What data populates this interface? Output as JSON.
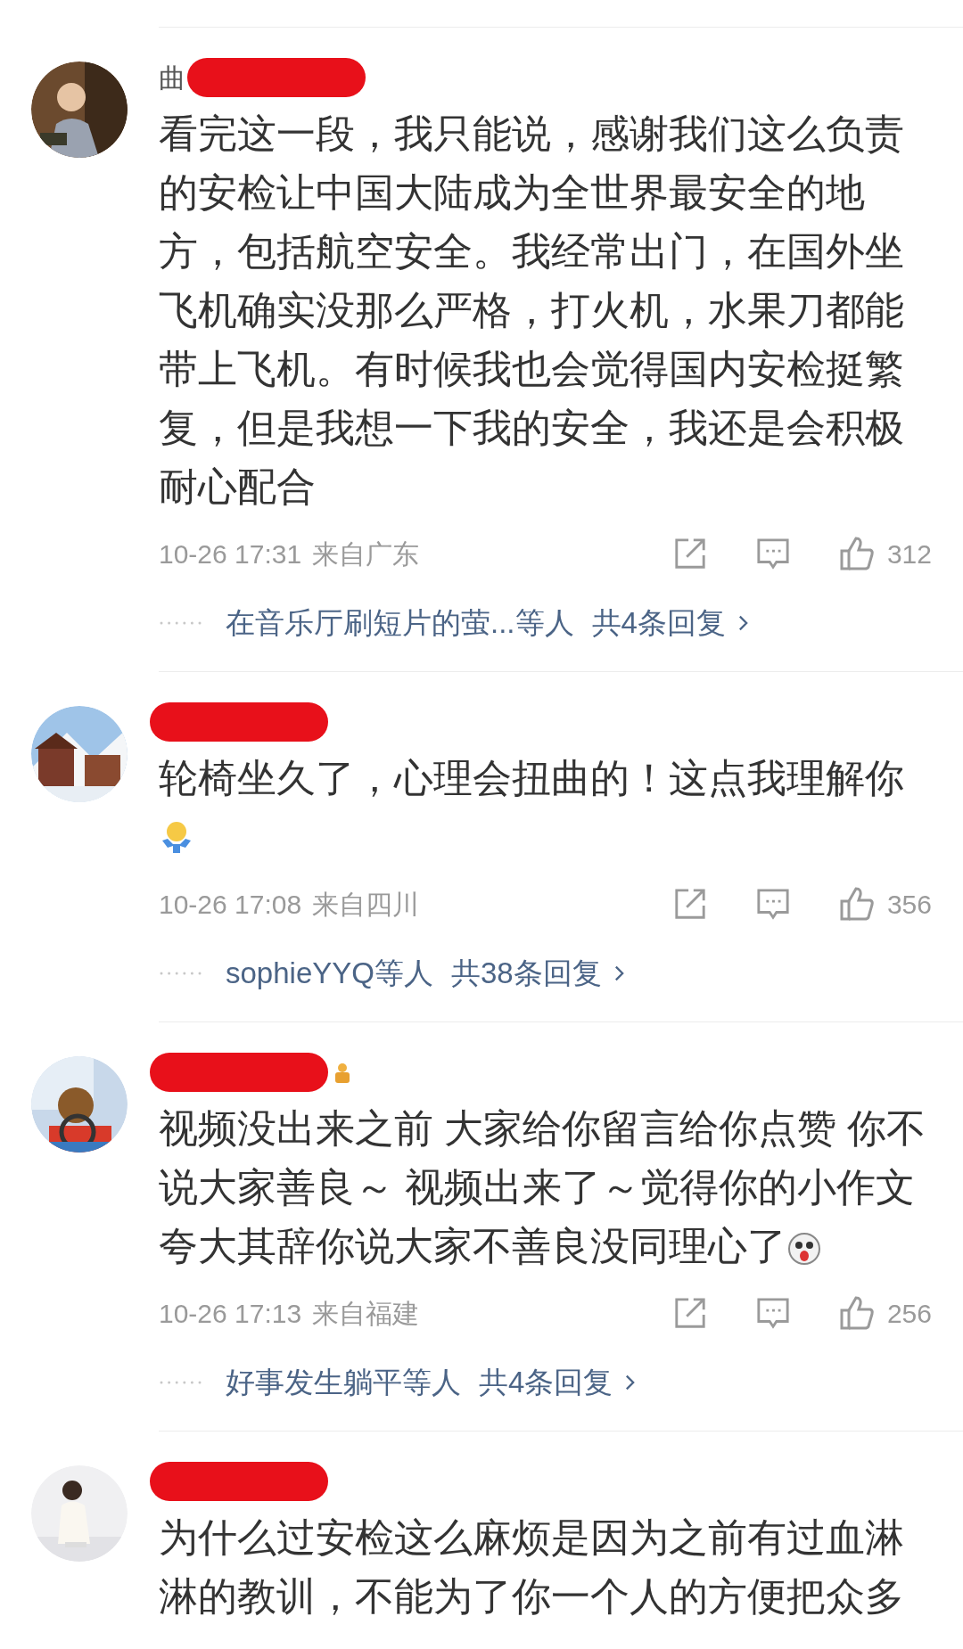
{
  "comments": [
    {
      "name": "曲",
      "redacted": true,
      "text": "看完这一段，我只能说，感谢我们这么负责的安检让中国大陆成为全世界最安全的地方，包括航空安全。我经常出门，在国外坐飞机确实没那么严格，打火机，水果刀都能带上飞机。有时候我也会觉得国内安检挺繁复，但是我想一下我的安全，我还是会积极耐心配合",
      "time": "10-26 17:31",
      "location": "来自广东",
      "likes": "312",
      "replies": {
        "names": "在音乐厅刷短片的萤...等人",
        "count": "共4条回复"
      }
    },
    {
      "redacted": true,
      "text": "轮椅坐久了，心理会扭曲的！这点我理解你",
      "emoji": {
        "kind": "shrug"
      },
      "time": "10-26 17:08",
      "location": "来自四川",
      "likes": "356",
      "replies": {
        "names": "sophieYYQ等人",
        "count": "共38条回复"
      }
    },
    {
      "redacted": true,
      "badge": true,
      "text": "视频没出来之前 大家给你留言给你点赞 你不说大家善良～ 视频出来了～觉得你的小作文夸大其辞你说大家不善良没同理心了",
      "emoji": {
        "kind": "surprised"
      },
      "time": "10-26 17:13",
      "location": "来自福建",
      "likes": "256",
      "replies": {
        "names": "好事发生躺平等人",
        "count": "共4条回复"
      }
    },
    {
      "redacted": true,
      "text": "为什么过安检这么麻烦是因为之前有过血淋淋的教训，不能为了你一个人的方便把众多"
    }
  ]
}
